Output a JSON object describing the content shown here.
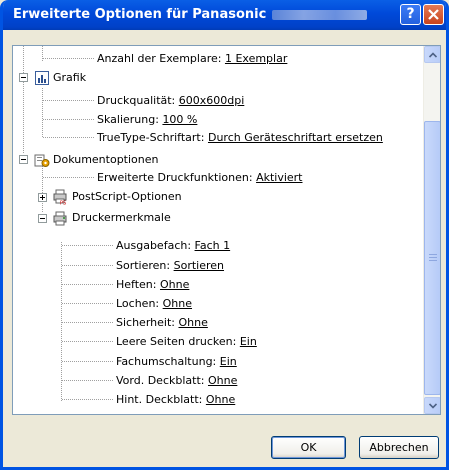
{
  "window": {
    "title": "Erweiterte Optionen für Panasonic",
    "help_button": "?",
    "close_button": "close"
  },
  "tree": [
    {
      "label": "Anzahl der Exemplare:",
      "value": "1 Exemplar"
    },
    {
      "label": "Grafik",
      "icon": "graphics-icon"
    },
    {
      "label": "Druckqualität:",
      "value": "600x600dpi"
    },
    {
      "label": "Skalierung:",
      "value": "100 %"
    },
    {
      "label": "TrueType-Schriftart:",
      "value": "Durch Geräteschriftart ersetzen"
    },
    {
      "label": "Dokumentoptionen",
      "icon": "document-options-icon"
    },
    {
      "label": "Erweiterte Druckfunktionen:",
      "value": "Aktiviert"
    },
    {
      "label": "PostScript-Optionen",
      "icon": "postscript-icon"
    },
    {
      "label": "Druckermerkmale",
      "icon": "printer-features-icon"
    },
    {
      "label": "Ausgabefach:",
      "value": "Fach 1"
    },
    {
      "label": "Sortieren:",
      "value": "Sortieren"
    },
    {
      "label": "Heften:",
      "value": "Ohne"
    },
    {
      "label": "Lochen:",
      "value": "Ohne"
    },
    {
      "label": "Sicherheit:",
      "value": "Ohne"
    },
    {
      "label": "Leere Seiten drucken:",
      "value": "Ein"
    },
    {
      "label": "Fachumschaltung:",
      "value": "Ein"
    },
    {
      "label": "Vord. Deckblatt:",
      "value": "Ohne"
    },
    {
      "label": "Hint. Deckblatt:",
      "value": "Ohne"
    }
  ],
  "buttons": {
    "ok": "OK",
    "cancel": "Abbrechen"
  },
  "colors": {
    "titlebar": "#0054e3",
    "dialog_bg": "#ece9d8",
    "scrollbar_thumb": "#c1d3fb",
    "button_border": "#003c74"
  }
}
